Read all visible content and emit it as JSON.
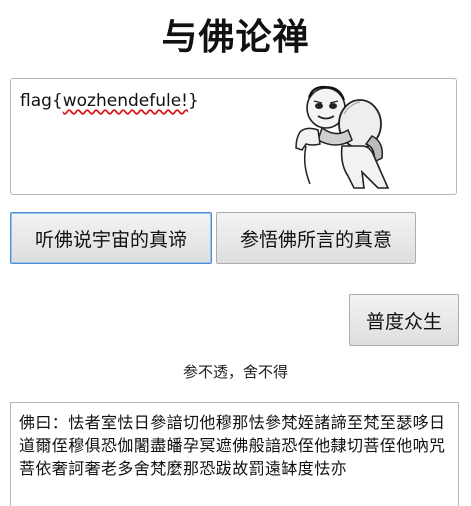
{
  "title": "与佛论禅",
  "input": {
    "value_prefix": "flag{",
    "value_word": "wozhendefule!",
    "value_suffix": "}"
  },
  "meme": {
    "icon": "panda-meme-hug-icon"
  },
  "buttons": {
    "encode": "听佛说宇宙的真谛",
    "decode": "参悟佛所言的真意",
    "clear": "普度众生"
  },
  "caption": "参不透，舍不得",
  "output": {
    "text": "佛曰：怯者室怯日參諳切他穆那怯參梵姪諸諦至梵至瑟哆日道爾侄穆俱恐伽闍盡皤孕冥遮佛般諳恐侄他隸切菩侄他吶咒菩依奢訶奢老多舍梵麼那恐跋故罰遠缽度怯亦"
  }
}
